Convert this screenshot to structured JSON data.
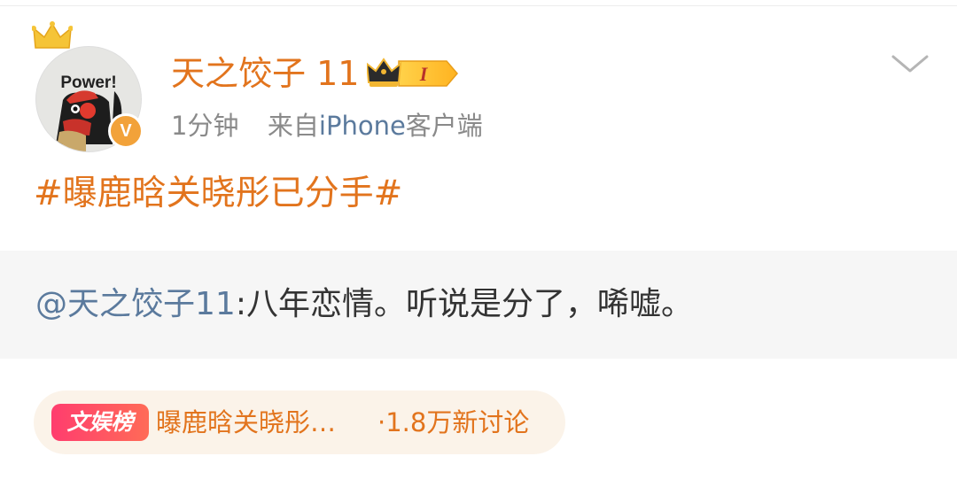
{
  "post": {
    "author": {
      "name": "天之饺子 11",
      "avatar_text": "Power!",
      "verified_badge": "V",
      "level_badge": "I"
    },
    "meta": {
      "time": "1分钟",
      "source_prefix": "来自",
      "source_device": "iPhone",
      "source_suffix": "客户端"
    },
    "topic": "#曝鹿晗关晓彤已分手#",
    "quote": {
      "mention": "@天之饺子11",
      "text": ":八年恋情。听说是分了，唏嘘。"
    },
    "hot_search": {
      "tag": "文娱榜",
      "title": "曝鹿晗关晓彤…",
      "count": "·1.8万新讨论"
    }
  },
  "colors": {
    "accent_orange": "#e2741d",
    "link_blue": "#5b7a9d",
    "meta_gray": "#8a8a8a",
    "quote_bg": "#f6f6f6",
    "pill_bg": "#fbf3e9",
    "tag_gradient_start": "#ff3d6e",
    "tag_gradient_end": "#ff6b57"
  },
  "icons": {
    "crown": "crown-icon",
    "level_badge": "level-badge-icon",
    "expand": "chevron-down-icon"
  }
}
